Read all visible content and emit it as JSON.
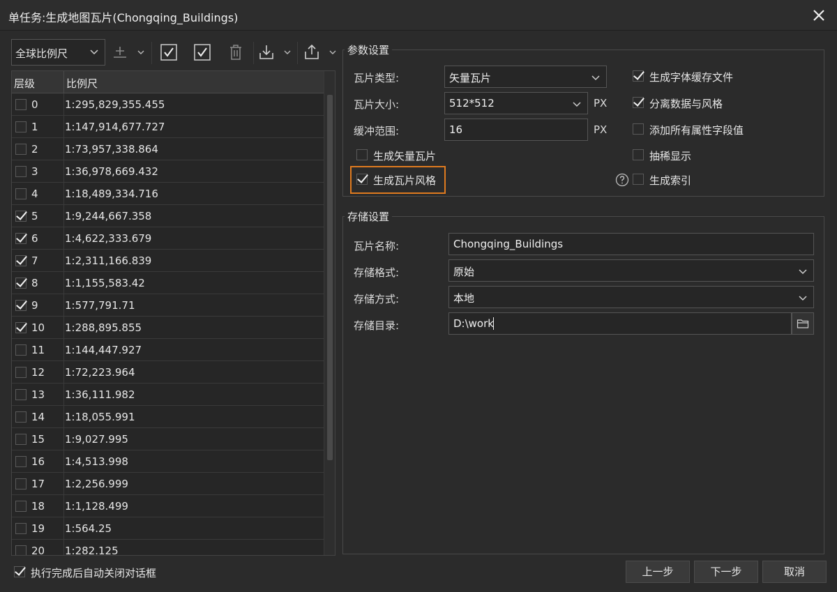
{
  "window": {
    "title": "单任务:生成地图瓦片(Chongqing_Buildings)"
  },
  "toolbar": {
    "scale_combo": "全球比例尺"
  },
  "table": {
    "headers": [
      "层级",
      "比例尺"
    ],
    "rows": [
      {
        "level": "0",
        "scale": "1:295,829,355.455",
        "checked": false
      },
      {
        "level": "1",
        "scale": "1:147,914,677.727",
        "checked": false
      },
      {
        "level": "2",
        "scale": "1:73,957,338.864",
        "checked": false
      },
      {
        "level": "3",
        "scale": "1:36,978,669.432",
        "checked": false
      },
      {
        "level": "4",
        "scale": "1:18,489,334.716",
        "checked": false
      },
      {
        "level": "5",
        "scale": "1:9,244,667.358",
        "checked": true
      },
      {
        "level": "6",
        "scale": "1:4,622,333.679",
        "checked": true
      },
      {
        "level": "7",
        "scale": "1:2,311,166.839",
        "checked": true
      },
      {
        "level": "8",
        "scale": "1:1,155,583.42",
        "checked": true
      },
      {
        "level": "9",
        "scale": "1:577,791.71",
        "checked": true
      },
      {
        "level": "10",
        "scale": "1:288,895.855",
        "checked": true
      },
      {
        "level": "11",
        "scale": "1:144,447.927",
        "checked": false
      },
      {
        "level": "12",
        "scale": "1:72,223.964",
        "checked": false
      },
      {
        "level": "13",
        "scale": "1:36,111.982",
        "checked": false
      },
      {
        "level": "14",
        "scale": "1:18,055.991",
        "checked": false
      },
      {
        "level": "15",
        "scale": "1:9,027.995",
        "checked": false
      },
      {
        "level": "16",
        "scale": "1:4,513.998",
        "checked": false
      },
      {
        "level": "17",
        "scale": "1:2,256.999",
        "checked": false
      },
      {
        "level": "18",
        "scale": "1:1,128.499",
        "checked": false
      },
      {
        "level": "19",
        "scale": "1:564.25",
        "checked": false
      },
      {
        "level": "20",
        "scale": "1:282.125",
        "checked": false
      }
    ]
  },
  "params": {
    "title": "参数设置",
    "tile_type_label": "瓦片类型:",
    "tile_type_value": "矢量瓦片",
    "tile_size_label": "瓦片大小:",
    "tile_size_value": "512*512",
    "buffer_label": "缓冲范围:",
    "buffer_value": "16",
    "unit": "PX",
    "gen_vector_tiles": "生成矢量瓦片",
    "gen_tile_style": "生成瓦片风格",
    "gen_font_cache": "生成字体缓存文件",
    "separate_data_style": "分离数据与风格",
    "add_all_attr": "添加所有属性字段值",
    "thin_display": "抽稀显示",
    "gen_index": "生成索引"
  },
  "storage": {
    "title": "存储设置",
    "name_label": "瓦片名称:",
    "name_value": "Chongqing_Buildings",
    "format_label": "存储格式:",
    "format_value": "原始",
    "method_label": "存储方式:",
    "method_value": "本地",
    "dir_label": "存储目录:",
    "dir_value": "D:\\work"
  },
  "footer": {
    "auto_close": "执行完成后自动关闭对话框",
    "prev": "上一步",
    "next": "下一步",
    "cancel": "取消"
  },
  "colors": {
    "highlight": "#e07b1f"
  }
}
